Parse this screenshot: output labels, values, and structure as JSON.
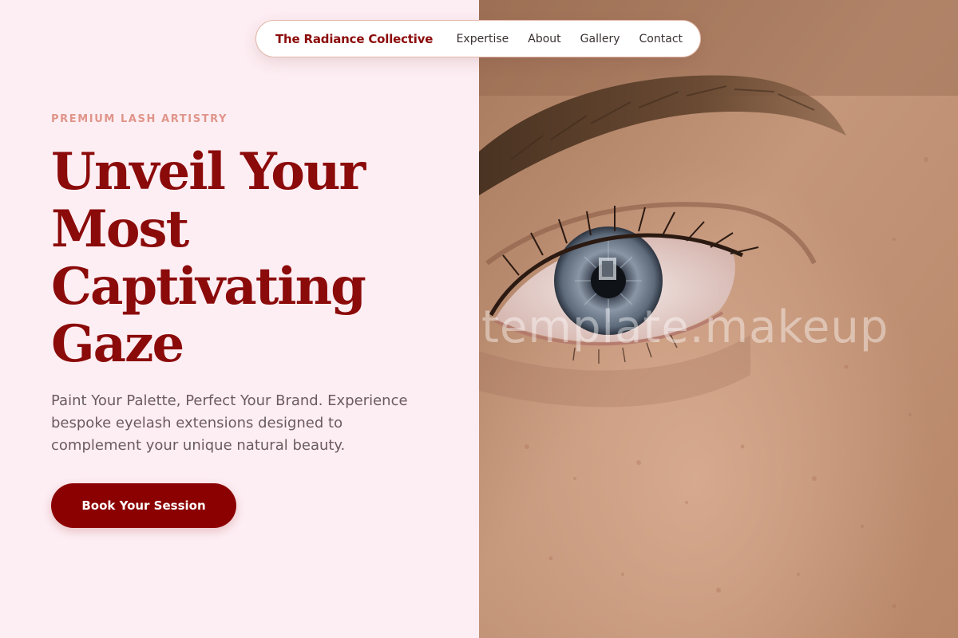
{
  "nav": {
    "brand": "The Radiance Collective",
    "links": [
      {
        "label": "Expertise"
      },
      {
        "label": "About"
      },
      {
        "label": "Gallery"
      },
      {
        "label": "Contact"
      }
    ]
  },
  "hero": {
    "eyebrow": "PREMIUM LASH ARTISTRY",
    "headline_lines": [
      "Unveil Your",
      "Most",
      "Captivating",
      "Gaze"
    ],
    "subtext": "Paint Your Palette, Perfect Your Brand. Experience bespoke eyelash extensions designed to complement your unique natural beauty.",
    "cta_label": "Book Your Session"
  },
  "image": {
    "subject": "close-up-eye-photo",
    "watermark": "template.makeup"
  },
  "colors": {
    "background": "#fdeef3",
    "brand": "#8b0a0a",
    "accent": "#e0958a",
    "button": "#8b0000"
  }
}
